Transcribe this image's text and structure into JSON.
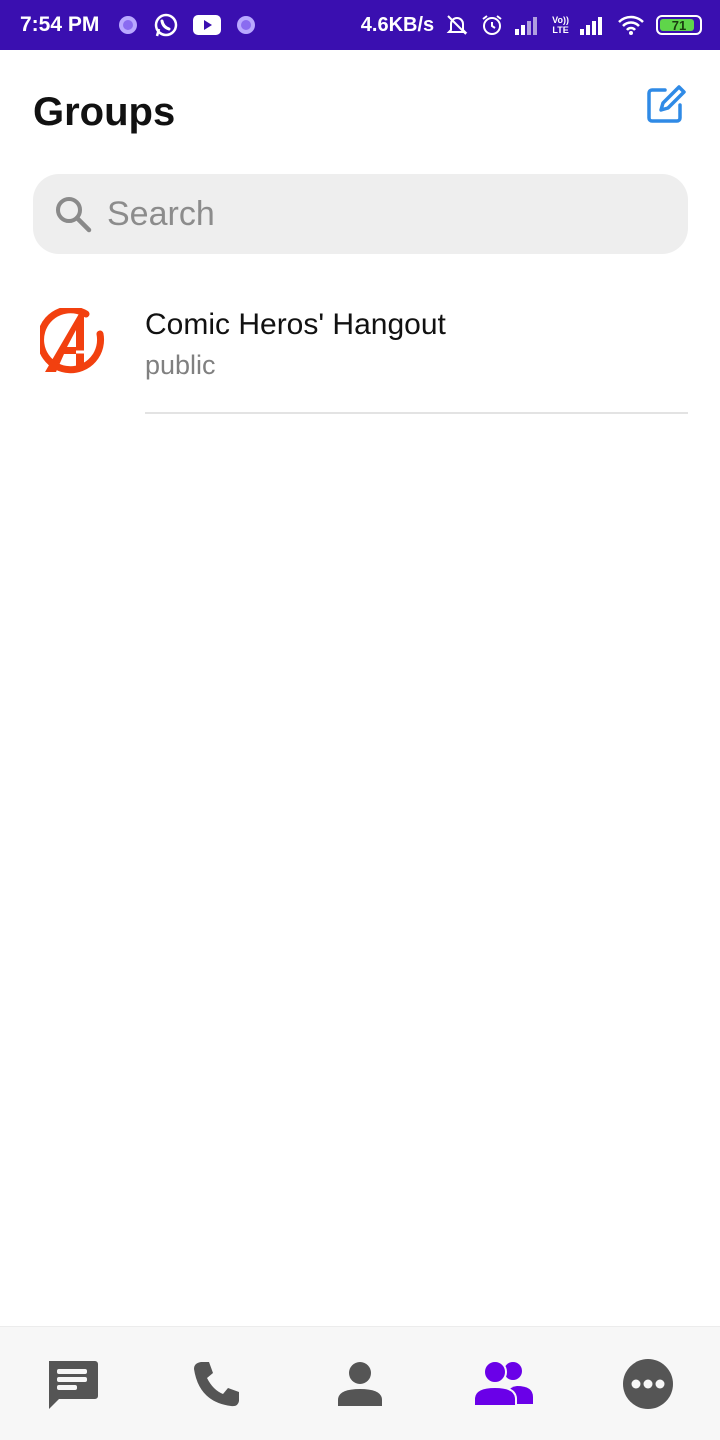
{
  "status_bar": {
    "time": "7:54 PM",
    "network_speed": "4.6KB/s",
    "lte_label_top": "Vo))",
    "lte_label_bottom": "LTE",
    "battery_level": "71",
    "background_color": "#3a0fb0"
  },
  "header": {
    "title": "Groups",
    "compose_icon": "compose-icon",
    "accent_color": "#2f8ae6"
  },
  "search": {
    "placeholder": "Search"
  },
  "groups": [
    {
      "name": "Comic Heros' Hangout",
      "type": "public",
      "avatar_icon": "avengers-logo-icon",
      "avatar_color": "#f2400f"
    }
  ],
  "bottom_nav": {
    "items": [
      {
        "icon": "chat-icon",
        "active": false
      },
      {
        "icon": "phone-icon",
        "active": false
      },
      {
        "icon": "user-icon",
        "active": false
      },
      {
        "icon": "groups-icon",
        "active": true
      },
      {
        "icon": "more-icon",
        "active": false
      }
    ],
    "active_color": "#6a00e8",
    "inactive_color": "#555555"
  }
}
